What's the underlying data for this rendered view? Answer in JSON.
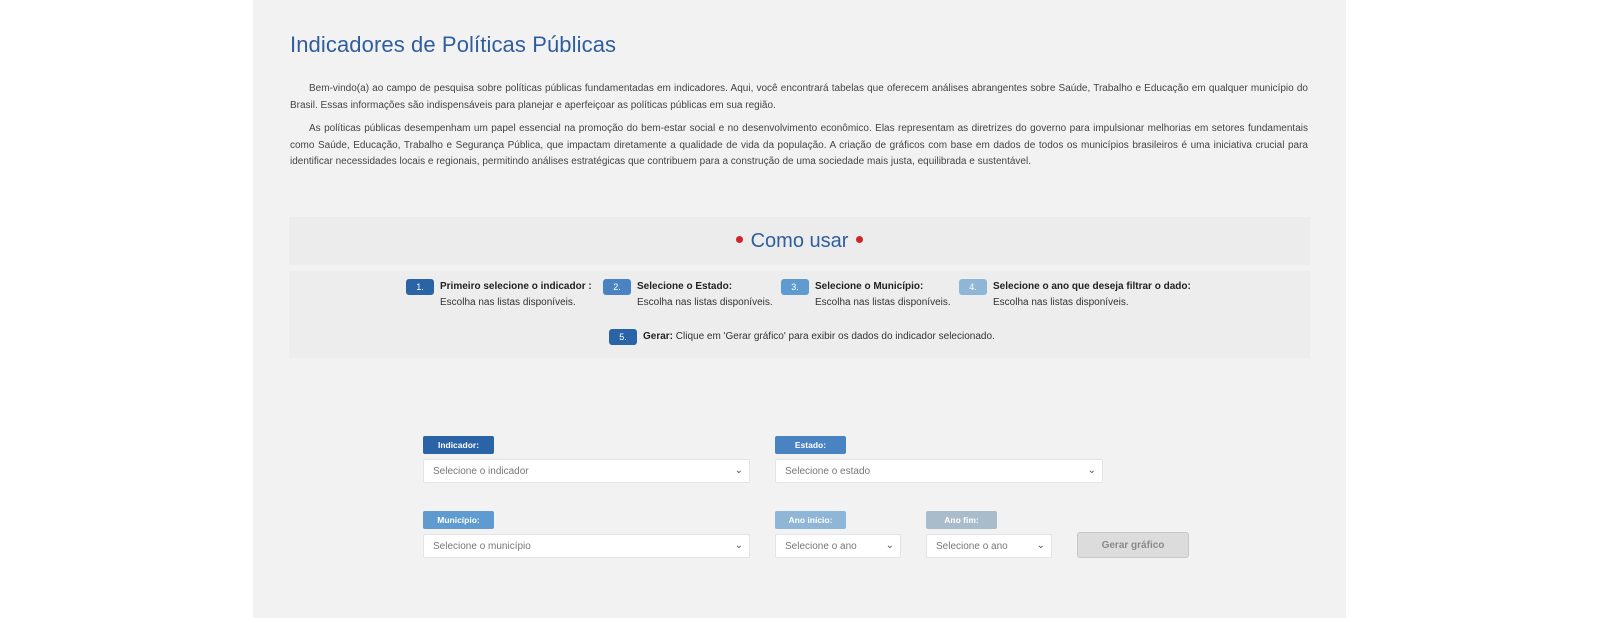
{
  "page": {
    "title": "Indicadores de Políticas Públicas",
    "intro_p1": "Bem-vindo(a) ao campo de pesquisa sobre políticas públicas fundamentadas em indicadores. Aqui, você encontrará tabelas que oferecem análises abrangentes sobre Saúde, Trabalho e Educação em qualquer município do Brasil. Essas informações são indispensáveis para planejar e aperfeiçoar as políticas públicas em sua região.",
    "intro_p2": "As políticas públicas desempenham um papel essencial na promoção do bem-estar social e no desenvolvimento econômico. Elas representam as diretrizes do governo para impulsionar melhorias em setores fundamentais como Saúde, Educação, Trabalho e Segurança Pública, que impactam diretamente a qualidade de vida da população. A criação de gráficos com base em dados de todos os municípios brasileiros é uma iniciativa crucial para identificar necessidades locais e regionais, permitindo análises estratégicas que contribuem para a construção de uma sociedade mais justa, equilibrada e sustentável."
  },
  "howto": {
    "title": "Como usar",
    "steps": [
      {
        "num": "1.",
        "title": "Primeiro selecione o indicador :",
        "desc": "Escolha nas listas disponíveis.",
        "color": "#2a63a6"
      },
      {
        "num": "2.",
        "title": "Selecione o Estado:",
        "desc": "Escolha nas listas disponíveis.",
        "color": "#4a83c2"
      },
      {
        "num": "3.",
        "title": "Selecione o Município:",
        "desc": "Escolha nas listas disponíveis.",
        "color": "#5f9bd0"
      },
      {
        "num": "4.",
        "title": "Selecione o ano que deseja filtrar o dado:",
        "desc": "Escolha nas listas disponíveis.",
        "color": "#8fb6d6"
      },
      {
        "num": "5.",
        "title": "Gerar:",
        "desc": "Clique em 'Gerar gráfico' para exibir os dados do indicador selecionado.",
        "color": "#2a63a6"
      }
    ]
  },
  "form": {
    "indicador": {
      "label": "Indicador:",
      "placeholder": "Selecione o indicador",
      "color": "#2a63a6"
    },
    "estado": {
      "label": "Estado:",
      "placeholder": "Selecione o estado",
      "color": "#4a83c2"
    },
    "municipio": {
      "label": "Município:",
      "placeholder": "Selecione o município",
      "color": "#5f9bd0"
    },
    "ano_inicio": {
      "label": "Ano início:",
      "placeholder": "Selecione o ano",
      "color": "#8fb6d6"
    },
    "ano_fim": {
      "label": "Ano fim:",
      "placeholder": "Selecione o ano",
      "color": "#a9bccb"
    },
    "submit_label": "Gerar gráfico"
  },
  "icons": {
    "dropdown": "chevron-down-icon"
  }
}
